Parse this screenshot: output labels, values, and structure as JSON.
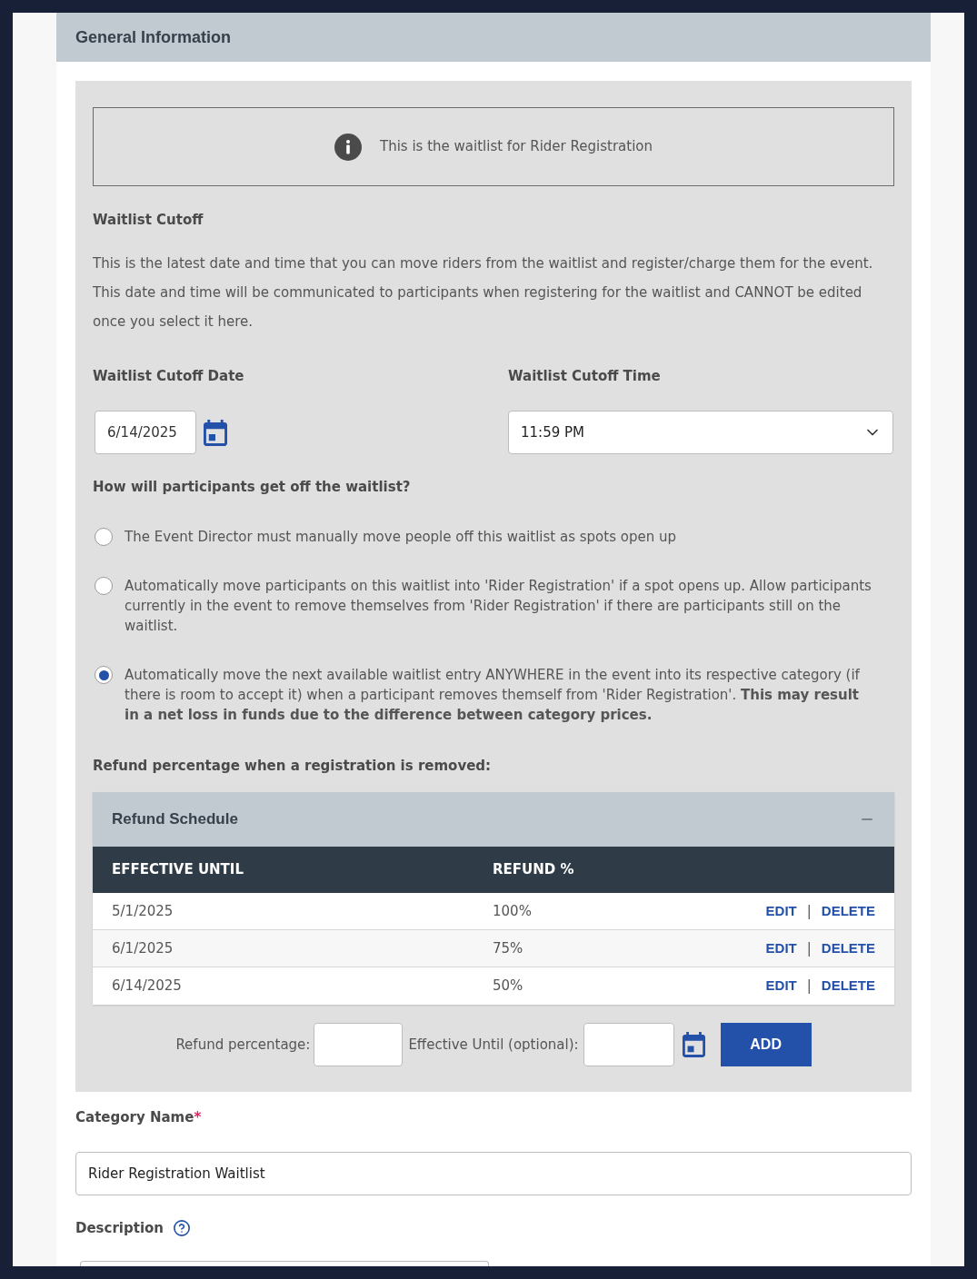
{
  "section": {
    "title": "General Information"
  },
  "info_banner": {
    "text": "This is the waitlist for Rider Registration"
  },
  "waitlist_cutoff": {
    "heading": "Waitlist Cutoff",
    "description": "This is the latest date and time that you can move riders from the waitlist and register/charge them for the event. This date and time will be communicated to participants when registering for the waitlist and CANNOT be edited once you select it here."
  },
  "cutoff_date": {
    "label": "Waitlist Cutoff Date",
    "value": "6/14/2025"
  },
  "cutoff_time": {
    "label": "Waitlist Cutoff Time",
    "value": "11:59 PM"
  },
  "waitlist_exit": {
    "question": "How will participants get off the waitlist?",
    "options": [
      {
        "text": "The Event Director must manually move people off this waitlist as spots open up",
        "selected": false
      },
      {
        "text": "Automatically move participants on this waitlist into 'Rider Registration' if a spot opens up. Allow participants currently in the event to remove themselves from 'Rider Registration' if there are participants still on the waitlist.",
        "selected": false
      },
      {
        "text": "Automatically move the next available waitlist entry ANYWHERE in the event into its respective category (if there is room to accept it) when a participant removes themself from 'Rider Registration'. **This may result in a net loss in funds due to the difference between category prices.**",
        "selected": true
      }
    ]
  },
  "refund": {
    "label": "Refund percentage when a registration is removed:",
    "schedule": {
      "title": "Refund Schedule",
      "expanded": true,
      "columns": [
        "EFFECTIVE UNTIL",
        "REFUND %"
      ],
      "rows": [
        {
          "effective_until": "5/1/2025",
          "refund": "100%",
          "edit": "EDIT",
          "separator": "|",
          "delete": "DELETE"
        },
        {
          "effective_until": "6/1/2025",
          "refund": "75%",
          "edit": "EDIT",
          "separator": "|",
          "delete": "DELETE"
        },
        {
          "effective_until": "6/14/2025",
          "refund": "50%",
          "edit": "EDIT",
          "separator": "|",
          "delete": "DELETE"
        }
      ]
    },
    "add_form": {
      "refund_label": "Refund percentage:",
      "effective_label": "Effective Until (optional):",
      "button": "ADD"
    }
  },
  "category_name": {
    "label": "Category Name",
    "required_mark": "*",
    "value": "Rider Registration Waitlist"
  },
  "description": {
    "label": "Description"
  }
}
